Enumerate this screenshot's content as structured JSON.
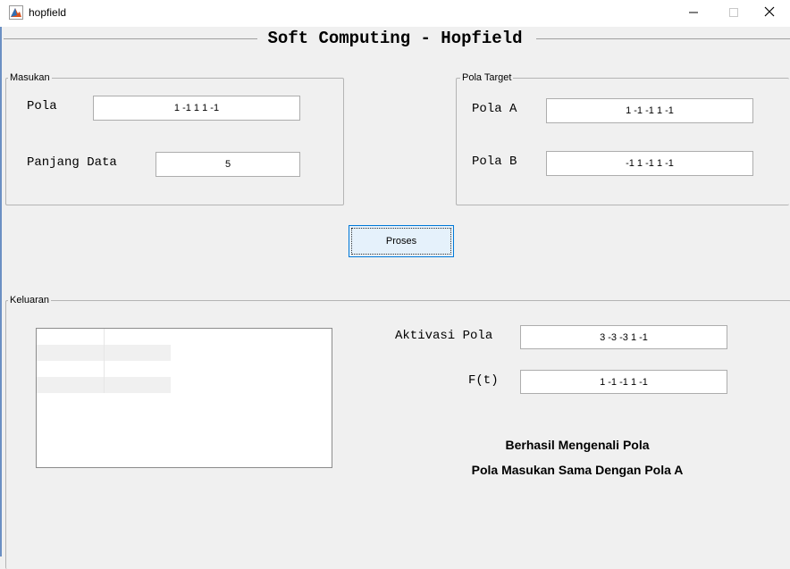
{
  "window": {
    "title": "hopfield"
  },
  "figure": {
    "title": "Soft Computing - Hopfield"
  },
  "masukan": {
    "title": "Masukan",
    "pola_label": "Pola",
    "pola_value": "1 -1 1 1 -1",
    "panjang_label": "Panjang Data",
    "panjang_value": "5"
  },
  "pola_target": {
    "title": "Pola Target",
    "a_label": "Pola A",
    "a_value": "1 -1 -1 1 -1",
    "b_label": "Pola B",
    "b_value": "-1 1 -1 1 -1"
  },
  "proses_button": "Proses",
  "keluaran": {
    "title": "Keluaran",
    "aktivasi_label": "Aktivasi Pola",
    "aktivasi_value": "3 -3 -3 1 -1",
    "ft_label": "F(t)",
    "ft_value": "1 -1 -1 1 -1",
    "result_line1": "Berhasil Mengenali Pola",
    "result_line2": "Pola Masukan Sama Dengan Pola A"
  },
  "colors": {
    "background": "#f0f0f0",
    "button_fill": "#e5f1fb",
    "button_border": "#0078d7",
    "table_stripe": "#f0f0f0"
  },
  "icons": [
    "matlab-figure-icon",
    "minimize-icon",
    "maximize-icon",
    "close-icon"
  ]
}
